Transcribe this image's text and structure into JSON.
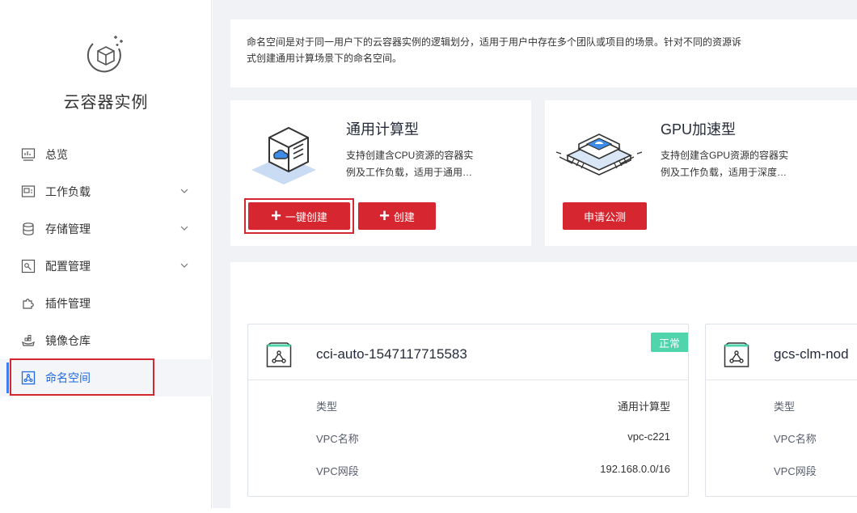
{
  "sidebar": {
    "product_title": "云容器实例",
    "items": [
      {
        "label": "总览"
      },
      {
        "label": "工作负载"
      },
      {
        "label": "存储管理"
      },
      {
        "label": "配置管理"
      },
      {
        "label": "插件管理"
      },
      {
        "label": "镜像仓库"
      },
      {
        "label": "命名空间"
      }
    ],
    "active_index": 6
  },
  "description": {
    "line1": "命名空间是对于同一用户下的云容器实例的逻辑划分，适用于用户中存在多个团队或项目的场景。针对不同的资源诉",
    "line2": "式创建通用计算场景下的命名空间。"
  },
  "type_cards": {
    "general": {
      "title": "通用计算型",
      "desc1": "支持创建含CPU资源的容器实",
      "desc2": "例及工作负载，适用于通用…",
      "one_click_label": "一键创建",
      "create_label": "创建",
      "plus": "+"
    },
    "gpu": {
      "title": "GPU加速型",
      "desc1": "支持创建含GPU资源的容器实",
      "desc2": "例及工作负载，适用于深度…",
      "apply_label": "申请公测"
    }
  },
  "namespaces": [
    {
      "name": "cci-auto-1547117715583",
      "status": "正常",
      "rows": [
        {
          "key": "类型",
          "value": "通用计算型"
        },
        {
          "key": "VPC名称",
          "value": "vpc-c221"
        },
        {
          "key": "VPC网段",
          "value": "192.168.0.0/16"
        }
      ]
    },
    {
      "name": "gcs-clm-nod",
      "rows": [
        {
          "key": "类型"
        },
        {
          "key": "VPC名称"
        },
        {
          "key": "VPC网段"
        }
      ]
    }
  ],
  "colors": {
    "accent_red": "#d6262f",
    "active_blue": "#1f6ae0",
    "status_green": "#50d4ab"
  }
}
